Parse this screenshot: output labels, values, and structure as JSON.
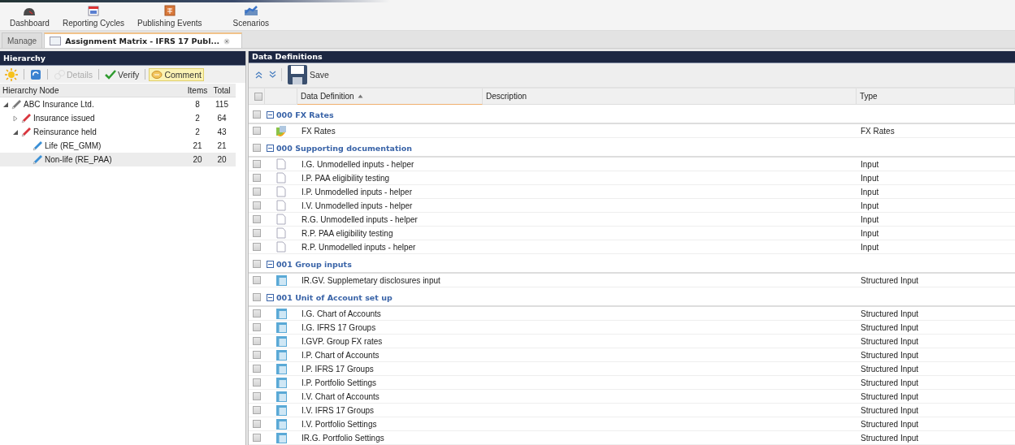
{
  "main_toolbar": [
    {
      "label": "Dashboard"
    },
    {
      "label": "Reporting Cycles"
    },
    {
      "label": "Publishing Events"
    },
    {
      "label": "Scenarios"
    }
  ],
  "tabs": [
    {
      "label": "Manage",
      "selected": false
    },
    {
      "label": "Assignment Matrix - IFRS 17 Publ...",
      "selected": true
    }
  ],
  "hierarchy": {
    "title": "Hierarchy",
    "toolbar": [
      {
        "kind": "icon",
        "disabled": false,
        "pressed": false
      },
      {
        "kind": "icon",
        "disabled": false,
        "pressed": false
      },
      {
        "kind": "text",
        "label": "Details",
        "disabled": true,
        "pressed": false
      },
      {
        "kind": "text",
        "label": "Verify",
        "disabled": false,
        "pressed": false
      },
      {
        "kind": "text",
        "label": "Comment",
        "disabled": false,
        "pressed": true
      }
    ],
    "columns": [
      "Hierarchy Node",
      "Items",
      "Total"
    ],
    "nodes": [
      {
        "name": "ABC Insurance Ltd.",
        "items": "8",
        "total": "115",
        "color": "#7a7a7a",
        "expanded": true,
        "selected": false,
        "children": [
          {
            "name": "Insurance issued",
            "items": "2",
            "total": "64",
            "color": "#d9363e",
            "expanded": false,
            "selected": false
          },
          {
            "name": "Reinsurance held",
            "items": "2",
            "total": "43",
            "color": "#d9363e",
            "expanded": true,
            "selected": false,
            "children": [
              {
                "name": "Life (RE_GMM)",
                "items": "21",
                "total": "21",
                "color": "#3a8fd6",
                "selected": false
              },
              {
                "name": "Non-life (RE_PAA)",
                "items": "20",
                "total": "20",
                "color": "#3a8fd6",
                "selected": true
              }
            ]
          }
        ]
      }
    ]
  },
  "definitions": {
    "title": "Data Definitions",
    "save_label": "Save",
    "header_checked": false,
    "columns": [
      {
        "label": "Data Definition",
        "sorted": true
      },
      {
        "label": "Description",
        "sorted": false
      },
      {
        "label": "Type",
        "sorted": false
      }
    ],
    "rows": [
      {
        "kind": "group",
        "label": "000 FX Rates",
        "expanded": true,
        "checked": false
      },
      {
        "kind": "rates",
        "name": "FX Rates",
        "type": "FX Rates",
        "checked": false
      },
      {
        "kind": "group",
        "label": "000 Supporting documentation",
        "expanded": true,
        "checked": false
      },
      {
        "kind": "document",
        "name": "I.G. Unmodelled inputs - helper",
        "type": "Input",
        "checked": false
      },
      {
        "kind": "document",
        "name": "I.P. PAA eligibility testing",
        "type": "Input",
        "checked": false
      },
      {
        "kind": "document",
        "name": "I.P. Unmodelled inputs - helper",
        "type": "Input",
        "checked": false
      },
      {
        "kind": "document",
        "name": "I.V. Unmodelled inputs - helper",
        "type": "Input",
        "checked": false
      },
      {
        "kind": "document",
        "name": "R.G. Unmodelled inputs - helper",
        "type": "Input",
        "checked": false
      },
      {
        "kind": "document",
        "name": "R.P. PAA eligibility testing",
        "type": "Input",
        "checked": false
      },
      {
        "kind": "document",
        "name": "R.P. Unmodelled inputs - helper",
        "type": "Input",
        "checked": false
      },
      {
        "kind": "group",
        "label": "001 Group inputs",
        "expanded": true,
        "checked": false
      },
      {
        "kind": "form",
        "name": "IR.GV. Supplemetary disclosures input",
        "type": "Structured Input",
        "checked": false
      },
      {
        "kind": "group",
        "label": "001 Unit of Account set up",
        "expanded": true,
        "checked": false
      },
      {
        "kind": "form",
        "name": "I.G. Chart of Accounts",
        "type": "Structured Input",
        "checked": false
      },
      {
        "kind": "form",
        "name": "I.G. IFRS 17 Groups",
        "type": "Structured Input",
        "checked": false
      },
      {
        "kind": "form",
        "name": "I.GVP. Group FX rates",
        "type": "Structured Input",
        "checked": false
      },
      {
        "kind": "form",
        "name": "I.P. Chart of Accounts",
        "type": "Structured Input",
        "checked": false
      },
      {
        "kind": "form",
        "name": "I.P. IFRS 17 Groups",
        "type": "Structured Input",
        "checked": false
      },
      {
        "kind": "form",
        "name": "I.P. Portfolio Settings",
        "type": "Structured Input",
        "checked": false
      },
      {
        "kind": "form",
        "name": "I.V. Chart of Accounts",
        "type": "Structured Input",
        "checked": false
      },
      {
        "kind": "form",
        "name": "I.V. IFRS 17 Groups",
        "type": "Structured Input",
        "checked": false
      },
      {
        "kind": "form",
        "name": "I.V. Portfolio Settings",
        "type": "Structured Input",
        "checked": false
      },
      {
        "kind": "form",
        "name": "IR.G. Portfolio Settings",
        "type": "Structured Input",
        "checked": false
      }
    ]
  }
}
